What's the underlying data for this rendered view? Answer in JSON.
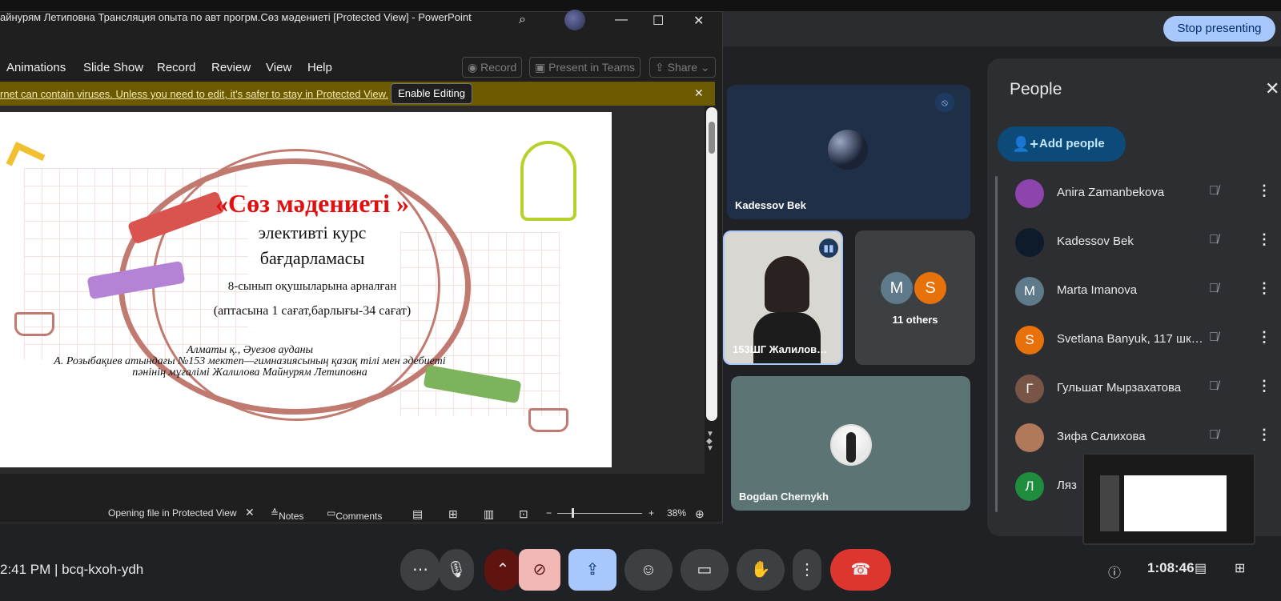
{
  "powerpoint": {
    "title": "айнурям Летиповна Трансляция опыта по авт прогрм.Сөз мәдениеті [Protected View]  -  PowerPoint",
    "menu": [
      "Animations",
      "Slide Show",
      "Record",
      "Review",
      "View",
      "Help"
    ],
    "ribbon_buttons": {
      "record": "Record",
      "present_teams": "Present in Teams",
      "share": "Share"
    },
    "protected_warning": "rnet can contain viruses. Unless you need to edit, it's safer to stay in Protected View.",
    "enable_editing": "Enable Editing",
    "slide": {
      "title": "«Сөз мәдениеті »",
      "line1": "элективті курс",
      "line2": "бағдарламасы",
      "line3": "8-сынып оқушыларына арналған",
      "line4": "(аптасына 1 сағат,барлығы-34 сағат)",
      "author1": "Алматы қ., Әуезов ауданы",
      "author2": "А. Розыбақиев атындағы №153 мектеп—гимназиясының қазақ тілі мен әдебиеті",
      "author3": "пәнінің мұғалімі Жалилова Майнурям Летиповна"
    },
    "status": {
      "opening": "Opening file in Protected View",
      "notes": "Notes",
      "comments": "Comments",
      "zoom": "38%"
    }
  },
  "meet": {
    "stop_presenting": "Stop presenting",
    "tiles": {
      "kadessov": "Kadessov Bek",
      "shg": "153ШГ Жалилов…",
      "others": "11 others",
      "others_initials": [
        "M",
        "S"
      ],
      "bogdan": "Bogdan Chernykh"
    },
    "people": {
      "title": "People",
      "add_people": "Add people",
      "list": [
        {
          "name": "Anira Zamanbekova",
          "initial": "",
          "color": "#8e44ad"
        },
        {
          "name": "Kadessov Bek",
          "initial": "",
          "color": "#0d1b2a"
        },
        {
          "name": "Marta Imanova",
          "initial": "M",
          "color": "#5f7a8a"
        },
        {
          "name": "Svetlana Banyuk, 117 шк…",
          "initial": "S",
          "color": "#e8710a"
        },
        {
          "name": "Гульшат Мырзахатова",
          "initial": "Г",
          "color": "#795548"
        },
        {
          "name": "Зифа Салихова",
          "initial": "",
          "color": "#b07a5a"
        },
        {
          "name": "Ляз",
          "initial": "Л",
          "color": "#1e8e3e"
        }
      ]
    },
    "bottom": {
      "time_code": "2:41 PM  |  bcq-kxoh-ydh",
      "clock": "1:08:46"
    }
  }
}
